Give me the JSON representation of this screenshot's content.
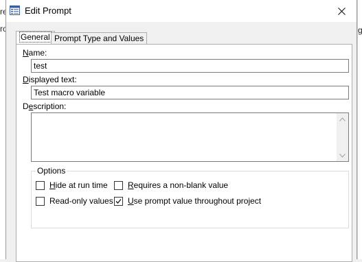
{
  "window": {
    "title": "Edit Prompt"
  },
  "background": {
    "left_letters": [
      "re",
      "ro"
    ],
    "right_letter": "g"
  },
  "tabs": [
    {
      "label": "General",
      "active": true
    },
    {
      "label": "Prompt Type and Values",
      "active": false
    }
  ],
  "fields": {
    "name": {
      "label_mnemonic": "N",
      "label_rest": "ame:",
      "value": "test"
    },
    "displayed_text": {
      "label_mnemonic": "D",
      "label_rest": "isplayed text:",
      "value": "Test macro variable"
    },
    "description": {
      "label_pre": "D",
      "label_mnemonic": "e",
      "label_rest": "scription:",
      "value": ""
    }
  },
  "options": {
    "title": "Options",
    "hide_at_run_time": {
      "label_mnemonic": "H",
      "label_rest": "ide at run time",
      "checked": false
    },
    "read_only": {
      "label": "Read-only values",
      "checked": false
    },
    "requires_non_blank": {
      "label_mnemonic": "R",
      "label_rest": "equires a non-blank value",
      "checked": false
    },
    "use_prompt_value": {
      "label_mnemonic": "U",
      "label_rest": "se prompt value throughout project",
      "checked": true
    }
  },
  "icons": {
    "app": "dialog-window-icon",
    "close": "close-icon",
    "check": "check-icon"
  }
}
